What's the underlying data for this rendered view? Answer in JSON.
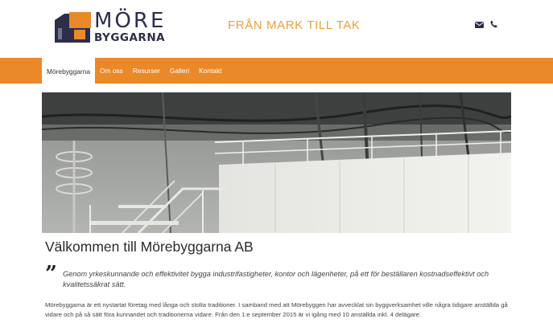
{
  "header": {
    "logo_top": "MÖRE",
    "logo_bottom": "BYGGARNA",
    "tagline": "FRÅN MARK TILL TAK",
    "icons": [
      "envelope-icon",
      "phone-icon"
    ]
  },
  "nav": {
    "items": [
      {
        "label": "Mörebyggarna",
        "active": true
      },
      {
        "label": "Om oss",
        "active": false
      },
      {
        "label": "Resurser",
        "active": false
      },
      {
        "label": "Galleri",
        "active": false
      },
      {
        "label": "Kontakt",
        "active": false
      }
    ]
  },
  "main": {
    "title": "Välkommen till Mörebyggarna AB",
    "quote": "Genom yrkeskunnande och effektivitet bygga industrifastigheter, kontor och lägenheter, på ett för beställaren kostnadseffektivt och kvalitetssäkrat sätt.",
    "body": "Mörebyggarna är ett nystartat företag med långa och stolta traditioner. I samband med att Mörebyggen har avvecklat sin byggverksamhet ville några tidigare anställda gå vidare och på så sätt föra kunnandet och traditionerna vidare. Från den 1:e september 2015 är vi igång med 10 anställda inkl. 4 delägare."
  },
  "colors": {
    "accent": "#e9892a",
    "tagline": "#eca03b",
    "logo_navy": "#2c2e4a"
  }
}
